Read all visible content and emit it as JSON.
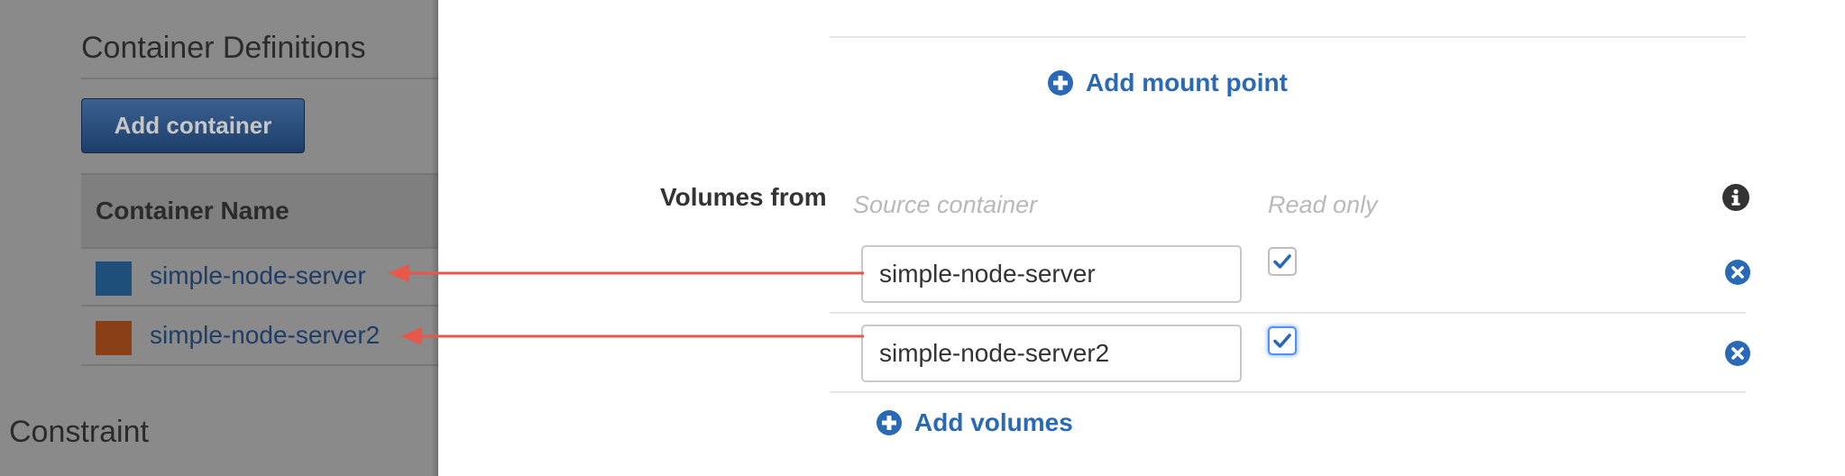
{
  "left": {
    "section_title": "Container Definitions",
    "add_container_label": "Add container",
    "table_header": "Container Name",
    "containers": [
      {
        "name": "simple-node-server",
        "color": "#1d4f7a"
      },
      {
        "name": "simple-node-server2",
        "color": "#8a3f16"
      }
    ],
    "constraint_title": "Constraint"
  },
  "right": {
    "add_mount_point_label": "Add mount point",
    "volumes_from_label": "Volumes from",
    "source_container_header": "Source container",
    "read_only_header": "Read only",
    "rows": [
      {
        "source": "simple-node-server",
        "read_only": true
      },
      {
        "source": "simple-node-server2",
        "read_only": true
      }
    ],
    "add_volumes_label": "Add volumes"
  },
  "icons": {
    "plus": "plus-circle-icon",
    "info": "info-icon",
    "remove": "remove-circle-icon",
    "check": "checkmark-icon"
  },
  "colors": {
    "link_blue": "#2a69b5",
    "annotation_arrow": "#e8574a"
  }
}
